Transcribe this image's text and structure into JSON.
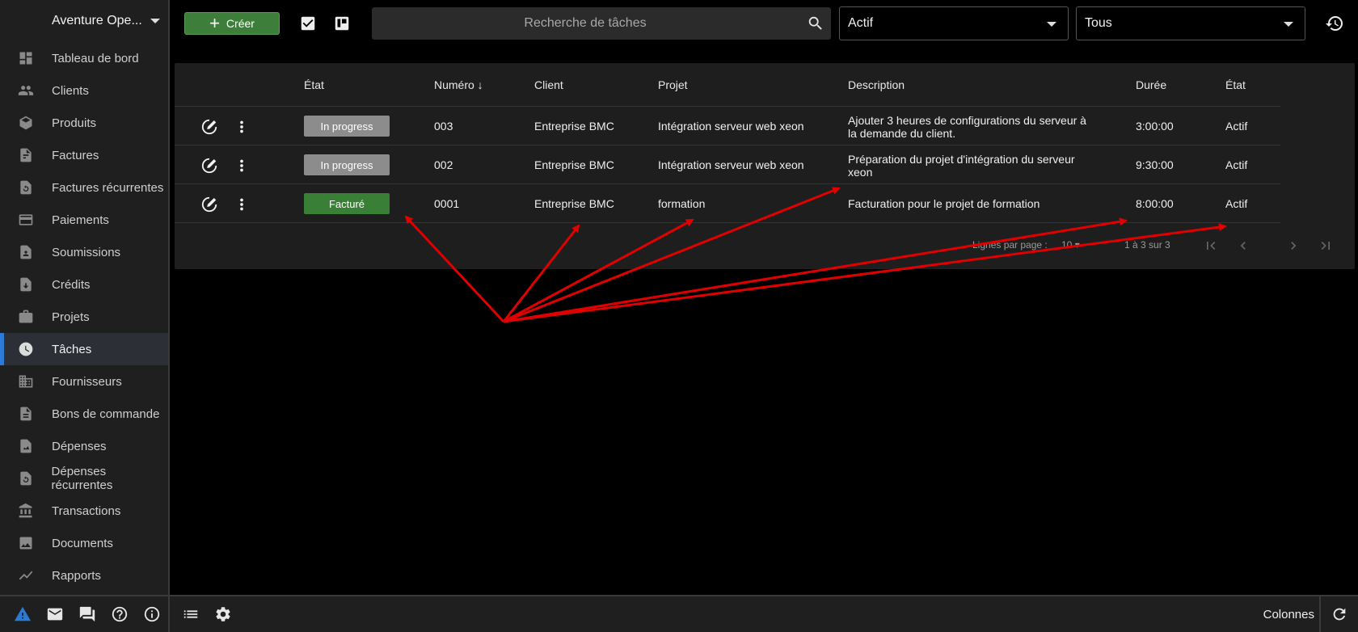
{
  "sidebar": {
    "company": "Aventure Ope...",
    "items": [
      {
        "label": "Tableau de bord",
        "icon": "dashboard-icon"
      },
      {
        "label": "Clients",
        "icon": "people-icon"
      },
      {
        "label": "Produits",
        "icon": "cube-icon"
      },
      {
        "label": "Factures",
        "icon": "invoice-icon"
      },
      {
        "label": "Factures récurrentes",
        "icon": "recurring-invoice-icon"
      },
      {
        "label": "Paiements",
        "icon": "credit-card-icon"
      },
      {
        "label": "Soumissions",
        "icon": "quote-icon"
      },
      {
        "label": "Crédits",
        "icon": "credit-icon"
      },
      {
        "label": "Projets",
        "icon": "briefcase-icon"
      },
      {
        "label": "Tâches",
        "icon": "clock-icon"
      },
      {
        "label": "Fournisseurs",
        "icon": "building-icon"
      },
      {
        "label": "Bons de commande",
        "icon": "document-icon"
      },
      {
        "label": "Dépenses",
        "icon": "expense-icon"
      },
      {
        "label": "Dépenses récurrentes",
        "icon": "recurring-expense-icon"
      },
      {
        "label": "Transactions",
        "icon": "bank-icon"
      },
      {
        "label": "Documents",
        "icon": "image-icon"
      },
      {
        "label": "Rapports",
        "icon": "chart-icon"
      }
    ],
    "active_index": 9
  },
  "toolbar": {
    "create_label": "Créer",
    "search_placeholder": "Recherche de tâches",
    "status_filter": "Actif",
    "scope_filter": "Tous"
  },
  "table": {
    "headers": {
      "state": "État",
      "number": "Numéro",
      "client": "Client",
      "project": "Projet",
      "description": "Description",
      "duration": "Durée",
      "status": "État"
    },
    "rows": [
      {
        "state": "In progress",
        "number": "003",
        "client": "Entreprise BMC",
        "project": "Intégration serveur web xeon",
        "description": "Ajouter 3 heures de configurations du serveur à la demande du client.",
        "duration": "3:00:00",
        "status": "Actif"
      },
      {
        "state": "In progress",
        "number": "002",
        "client": "Entreprise BMC",
        "project": "Intégration serveur web xeon",
        "description": "Préparation du projet d'intégration du serveur xeon",
        "duration": "9:30:00",
        "status": "Actif"
      },
      {
        "state": "Facturé",
        "number": "0001",
        "client": "Entreprise BMC",
        "project": "formation",
        "description": "Facturation pour le projet de formation",
        "duration": "8:00:00",
        "status": "Actif"
      }
    ],
    "pagination": {
      "rows_per_page_label": "Lignes par page :",
      "rows_per_page": "10",
      "range": "1 à 3 sur 3"
    }
  },
  "footer": {
    "columns_label": "Colonnes"
  },
  "colors": {
    "accent": "#2b7bd6",
    "create_green": "#3d7f3a",
    "badge_grey": "#8c8c8c",
    "badge_green": "#3a7f36",
    "annotation_red": "#e00000"
  }
}
